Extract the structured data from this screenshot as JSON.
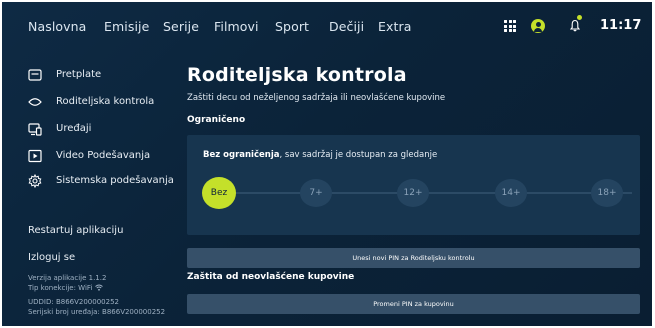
{
  "nav": {
    "items": [
      "Naslovna",
      "Emisije",
      "Serije",
      "Filmovi",
      "Sport",
      "Dečiji",
      "Extra"
    ],
    "time": "11:17",
    "icons": [
      "grid-icon",
      "user-icon",
      "bell-icon"
    ],
    "accent": "#c4e02a"
  },
  "sidebar": {
    "items": [
      {
        "label": "Pretplate",
        "icon": "subscription-card-icon"
      },
      {
        "label": "Roditeljska kontrola",
        "icon": "eye-icon"
      },
      {
        "label": "Uređaji",
        "icon": "devices-icon"
      },
      {
        "label": "Video Podešavanja",
        "icon": "play-icon"
      },
      {
        "label": "Sistemska podešavanja",
        "icon": "gear-icon"
      }
    ],
    "restart": "Restartuj aplikaciju",
    "logout": "Izloguj se",
    "version": "Verzija aplikacije 1.1.2",
    "connection": "Tip konekcije: WiFi",
    "udid": "UDDID: B866V200000252",
    "serial": "Serijski broj uređaja: B866V200000252"
  },
  "main": {
    "title": "Roditeljska kontrola",
    "subtitle": "Zaštiti decu od neželjenog sadržaja ili neovlašćene kupovine",
    "restricted_label": "Ograničeno",
    "panel_desc_bold": "Bez ograničenja",
    "panel_desc_rest": ", sav sadržaj je dostupan za gledanje",
    "levels": [
      "Bez",
      "7+",
      "12+",
      "14+",
      "18+"
    ],
    "selected_level": "Bez",
    "pin_button": "Unesi novi PIN za Roditeljsku kontrolu",
    "purchase_label": "Zaštita od neovlašćene kupovine",
    "purchase_button": "Promeni PIN za kupovinu"
  }
}
